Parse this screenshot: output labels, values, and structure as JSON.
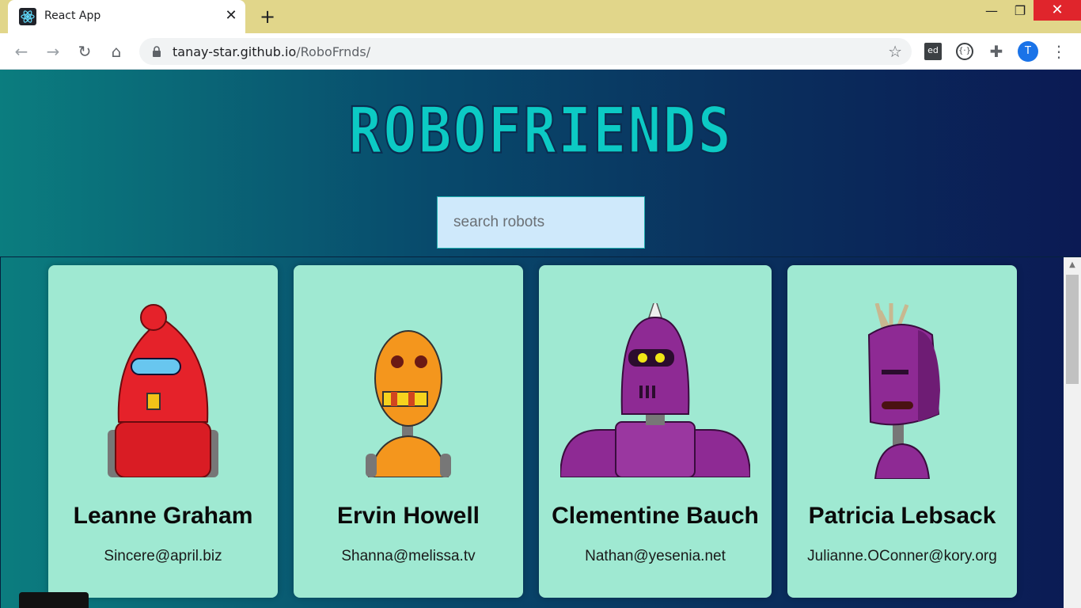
{
  "browser": {
    "tab_title": "React App",
    "tab_close": "✕",
    "new_tab": "+",
    "url_host": "tanay-star.github.io",
    "url_path": "/RoboFrnds/",
    "ext_ed_label": "ed",
    "ext_code_label": "{·}",
    "profile_initial": "T"
  },
  "app": {
    "title": "ROBOFRIENDS",
    "search_placeholder": "search robots"
  },
  "robots": [
    {
      "name": "Leanne Graham",
      "email": "Sincere@april.biz",
      "color": "#e5222a"
    },
    {
      "name": "Ervin Howell",
      "email": "Shanna@melissa.tv",
      "color": "#f4961d"
    },
    {
      "name": "Clementine Bauch",
      "email": "Nathan@yesenia.net",
      "color": "#8e2a94"
    },
    {
      "name": "Patricia Lebsack",
      "email": "Julianne.OConner@kory.org",
      "color": "#8e2a94"
    }
  ],
  "colors": {
    "card_bg": "#9fe9d2",
    "title_color": "#0ccac4",
    "search_bg": "#cfe9fb"
  }
}
